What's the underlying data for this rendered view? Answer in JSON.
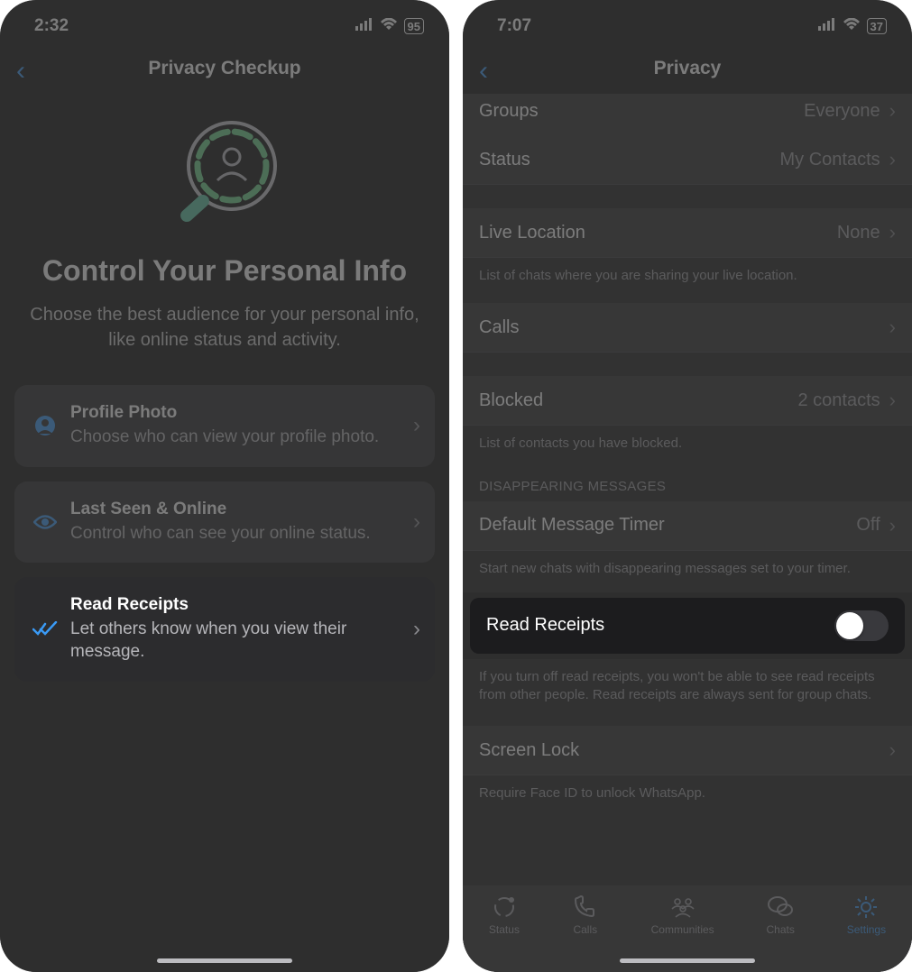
{
  "left": {
    "status": {
      "time": "2:32",
      "battery": "95"
    },
    "header_title": "Privacy Checkup",
    "hero_title": "Control Your Personal Info",
    "hero_sub": "Choose the best audience for your personal info, like online status and activity.",
    "cards": [
      {
        "title": "Profile Photo",
        "desc": "Choose who can view your profile photo."
      },
      {
        "title": "Last Seen & Online",
        "desc": "Control who can see your online status."
      },
      {
        "title": "Read Receipts",
        "desc": "Let others know when you view their message."
      }
    ]
  },
  "right": {
    "status": {
      "time": "7:07",
      "battery": "37"
    },
    "header_title": "Privacy",
    "rows": {
      "groups_label": "Groups",
      "groups_value": "Everyone",
      "status_label": "Status",
      "status_value": "My Contacts",
      "live_loc_label": "Live Location",
      "live_loc_value": "None",
      "live_loc_note": "List of chats where you are sharing your live location.",
      "calls_label": "Calls",
      "blocked_label": "Blocked",
      "blocked_value": "2 contacts",
      "blocked_note": "List of contacts you have blocked.",
      "disappearing_header": "Disappearing Messages",
      "timer_label": "Default Message Timer",
      "timer_value": "Off",
      "timer_note": "Start new chats with disappearing messages set to your timer.",
      "read_receipts_label": "Read Receipts",
      "read_receipts_note": "If you turn off read receipts, you won't be able to see read receipts from other people. Read receipts are always sent for group chats.",
      "screen_lock_label": "Screen Lock",
      "screen_lock_note": "Require Face ID to unlock WhatsApp."
    },
    "tabs": {
      "status": "Status",
      "calls": "Calls",
      "communities": "Communities",
      "chats": "Chats",
      "settings": "Settings"
    }
  }
}
